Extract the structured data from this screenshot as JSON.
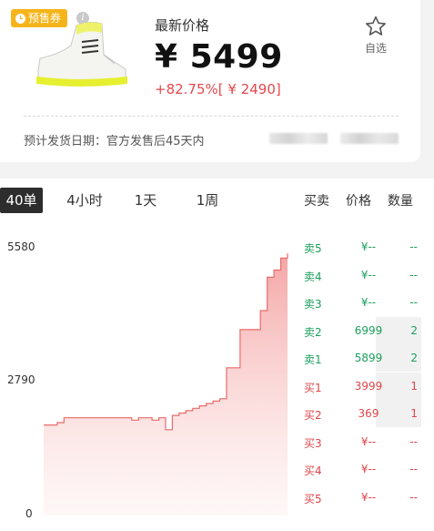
{
  "product": {
    "badge": "预售券",
    "latest_label": "最新价格",
    "price": "¥ 5499",
    "change": "+82.75%[ ¥ 2490]",
    "favorite_label": "自选",
    "shipping": "预计发货日期：官方发售后45天内"
  },
  "colors": {
    "accent_badge": "#f6b41b",
    "up_red": "#e5484d",
    "sell_green": "#1aa05c"
  },
  "tabs": [
    "40单",
    "4小时",
    "1天",
    "1周"
  ],
  "orderbook": {
    "headers": [
      "买卖",
      "价格",
      "数量"
    ],
    "sells": [
      {
        "side": "卖5",
        "price": "¥--",
        "qty": "--"
      },
      {
        "side": "卖4",
        "price": "¥--",
        "qty": "--"
      },
      {
        "side": "卖3",
        "price": "¥--",
        "qty": "--"
      },
      {
        "side": "卖2",
        "price": "6999",
        "qty": "2"
      },
      {
        "side": "卖1",
        "price": "5899",
        "qty": "2"
      }
    ],
    "buys": [
      {
        "side": "买1",
        "price": "3999",
        "qty": "1"
      },
      {
        "side": "买2",
        "price": "369",
        "qty": "1"
      },
      {
        "side": "买3",
        "price": "¥--",
        "qty": "--"
      },
      {
        "side": "买4",
        "price": "¥--",
        "qty": "--"
      },
      {
        "side": "买5",
        "price": "¥--",
        "qty": "--"
      }
    ]
  },
  "chart_data": {
    "type": "area",
    "y_ticks": [
      "5580",
      "2790",
      "0"
    ],
    "ylim": [
      0,
      5580
    ],
    "values": [
      1900,
      1900,
      1950,
      2050,
      2050,
      2050,
      2050,
      2050,
      2050,
      2050,
      2050,
      2050,
      2050,
      2000,
      2050,
      2050,
      2000,
      2050,
      1800,
      2100,
      2150,
      2200,
      2250,
      2300,
      2350,
      2400,
      2450,
      3100,
      3100,
      3900,
      3900,
      3900,
      4300,
      5000,
      5150,
      5400,
      5500
    ]
  }
}
